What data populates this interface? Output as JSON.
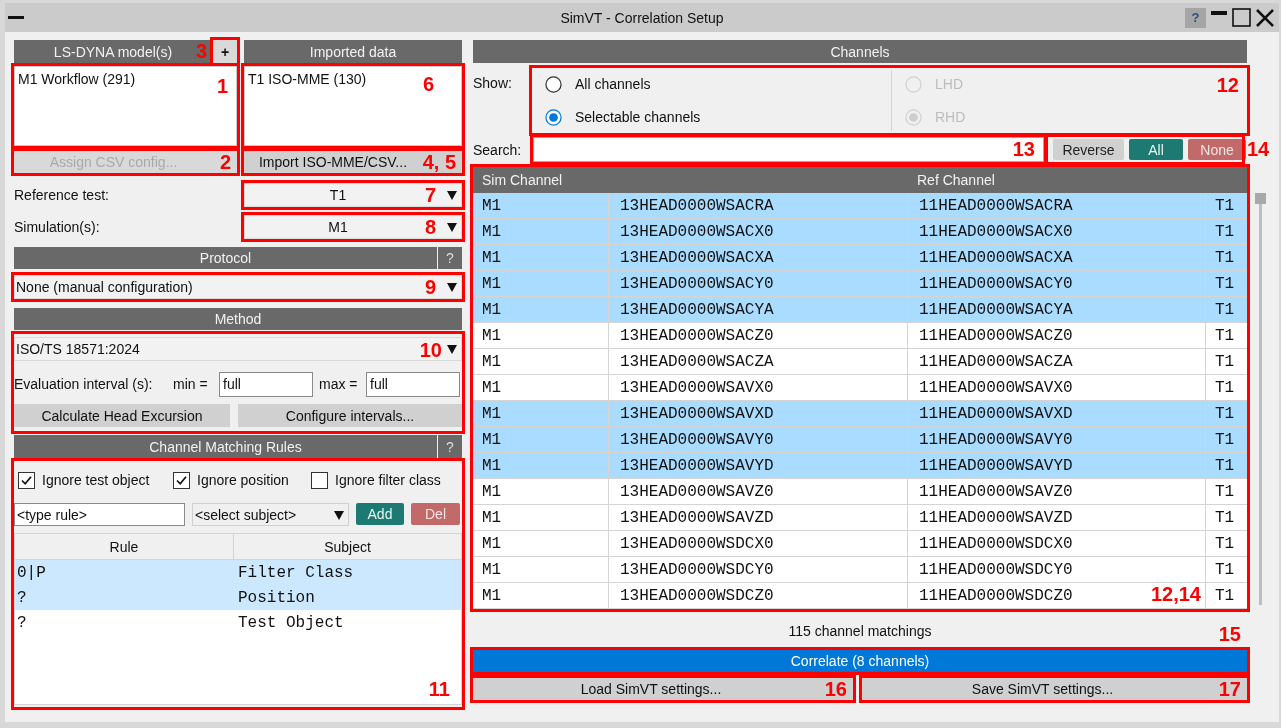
{
  "window": {
    "title": "SimVT - Correlation Setup",
    "help_button": "?"
  },
  "models": {
    "header": "LS-DYNA model(s)",
    "add_button": {
      "label": "+",
      "callout": "3"
    },
    "items": [
      "M1 Workflow (291)"
    ],
    "callout": "1",
    "assign_button": {
      "label": "Assign CSV config...",
      "disabled": true,
      "callout": "2"
    }
  },
  "imported": {
    "header": "Imported data",
    "items": [
      "T1 ISO-MME (130)"
    ],
    "callout": "6",
    "import_button": {
      "label": "Import ISO-MME/CSV...",
      "disabled": false,
      "callout": "4, 5"
    }
  },
  "reference_test": {
    "label": "Reference test:",
    "value": "T1",
    "callout": "7"
  },
  "simulations": {
    "label": "Simulation(s):",
    "value": "M1",
    "callout": "8"
  },
  "protocol": {
    "header": "Protocol",
    "help_button": "?",
    "value": "None (manual configuration)",
    "callout": "9"
  },
  "method": {
    "header": "Method",
    "value": "ISO/TS 18571:2024",
    "interval_label": "Evaluation interval (s):",
    "min_label": "min =",
    "min_value": "full",
    "max_label": "max =",
    "max_value": "full",
    "buttons": [
      "Calculate Head Excursion",
      "Configure intervals..."
    ],
    "callout": "10"
  },
  "matching_rules": {
    "header": "Channel Matching Rules",
    "help_button": "?",
    "options": [
      {
        "label": "Ignore test object",
        "checked": true
      },
      {
        "label": "Ignore position",
        "checked": true
      },
      {
        "label": "Ignore filter class",
        "checked": false
      }
    ],
    "rule_field": {
      "placeholder": "<type rule>"
    },
    "subject_select": "<select subject>",
    "buttons": [
      {
        "label": "Add",
        "kind": "accept"
      },
      {
        "label": "Del",
        "kind": "reject"
      }
    ],
    "columns": [
      "Rule",
      "Subject"
    ],
    "rows": [
      {
        "rule": "0|P",
        "subject": "Filter Class",
        "selected": true
      },
      {
        "rule": "?",
        "subject": "Position",
        "selected": true
      },
      {
        "rule": "?",
        "subject": "Test Object",
        "selected": false
      }
    ],
    "callout": "11"
  },
  "channels": {
    "header": "Channels",
    "show_label": "Show:",
    "show_options": [
      {
        "label": "All channels",
        "selected": false,
        "disabled": false
      },
      {
        "label": "Selectable channels",
        "selected": true,
        "disabled": false
      }
    ],
    "side_options": [
      {
        "label": "LHD",
        "selected": false,
        "disabled": true
      },
      {
        "label": "RHD",
        "selected": true,
        "disabled": true
      }
    ],
    "show_callout": "12",
    "search": {
      "label": "Search:",
      "callout": "13"
    },
    "selection_buttons": [
      {
        "label": "Reverse",
        "kind": "neutral"
      },
      {
        "label": "All",
        "kind": "accept"
      },
      {
        "label": "None",
        "kind": "reject"
      }
    ],
    "selection_callout": "14",
    "table": {
      "columns": [
        "Sim Channel",
        "",
        "Ref Channel",
        ""
      ],
      "rows": [
        {
          "cells": [
            "M1",
            "13HEAD0000WSACRA",
            "11HEAD0000WSACRA",
            "T1"
          ],
          "selected": true
        },
        {
          "cells": [
            "M1",
            "13HEAD0000WSACX0",
            "11HEAD0000WSACX0",
            "T1"
          ],
          "selected": true
        },
        {
          "cells": [
            "M1",
            "13HEAD0000WSACXA",
            "11HEAD0000WSACXA",
            "T1"
          ],
          "selected": true
        },
        {
          "cells": [
            "M1",
            "13HEAD0000WSACY0",
            "11HEAD0000WSACY0",
            "T1"
          ],
          "selected": true
        },
        {
          "cells": [
            "M1",
            "13HEAD0000WSACYA",
            "11HEAD0000WSACYA",
            "T1"
          ],
          "selected": true
        },
        {
          "cells": [
            "M1",
            "13HEAD0000WSACZ0",
            "11HEAD0000WSACZ0",
            "T1"
          ],
          "selected": false
        },
        {
          "cells": [
            "M1",
            "13HEAD0000WSACZA",
            "11HEAD0000WSACZA",
            "T1"
          ],
          "selected": false
        },
        {
          "cells": [
            "M1",
            "13HEAD0000WSAVX0",
            "11HEAD0000WSAVX0",
            "T1"
          ],
          "selected": false
        },
        {
          "cells": [
            "M1",
            "13HEAD0000WSAVXD",
            "11HEAD0000WSAVXD",
            "T1"
          ],
          "selected": true
        },
        {
          "cells": [
            "M1",
            "13HEAD0000WSAVY0",
            "11HEAD0000WSAVY0",
            "T1"
          ],
          "selected": true
        },
        {
          "cells": [
            "M1",
            "13HEAD0000WSAVYD",
            "11HEAD0000WSAVYD",
            "T1"
          ],
          "selected": true
        },
        {
          "cells": [
            "M1",
            "13HEAD0000WSAVZ0",
            "11HEAD0000WSAVZ0",
            "T1"
          ],
          "selected": false
        },
        {
          "cells": [
            "M1",
            "13HEAD0000WSAVZD",
            "11HEAD0000WSAVZD",
            "T1"
          ],
          "selected": false
        },
        {
          "cells": [
            "M1",
            "13HEAD0000WSDCX0",
            "11HEAD0000WSDCX0",
            "T1"
          ],
          "selected": false
        },
        {
          "cells": [
            "M1",
            "13HEAD0000WSDCY0",
            "11HEAD0000WSDCY0",
            "T1"
          ],
          "selected": false
        },
        {
          "cells": [
            "M1",
            "13HEAD0000WSDCZ0",
            "11HEAD0000WSDCZ0",
            "T1"
          ],
          "selected": false
        }
      ],
      "callout": "12,14"
    },
    "matchings_summary": "115 channel matchings",
    "correlate_button": {
      "label": "Correlate (8 channels)",
      "callout": "15"
    },
    "settings_buttons": [
      {
        "label": "Load SimVT settings...",
        "callout": "16"
      },
      {
        "label": "Save SimVT settings...",
        "callout": "17"
      }
    ]
  }
}
